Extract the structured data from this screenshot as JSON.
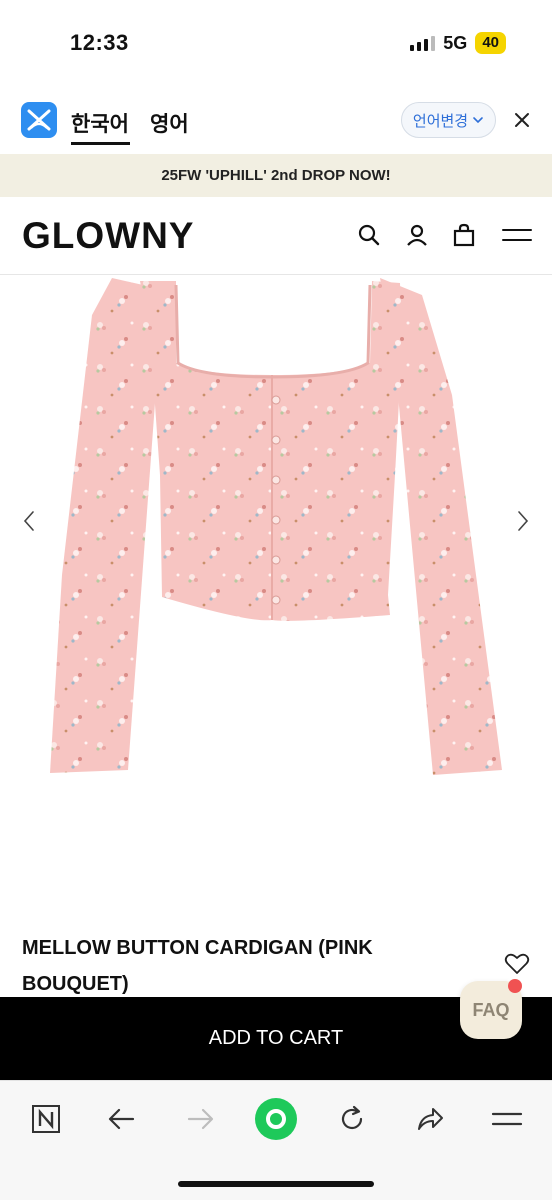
{
  "status_bar": {
    "time": "12:33",
    "network": "5G",
    "battery": "40",
    "accent": "#f5d400"
  },
  "translate_bar": {
    "icon": "translate-app-icon",
    "lang_active": "한국어",
    "lang_inactive": "영어",
    "change_label": "언어변경",
    "change_icon": "chevron-down-icon",
    "close_icon": "close-icon",
    "accent": "#2e8ef0"
  },
  "announcement": {
    "text": "25FW 'UPHILL' 2nd DROP NOW!"
  },
  "header": {
    "logo": "GLOWNY",
    "icons": [
      "search-icon",
      "user-icon",
      "shopping-bag-icon",
      "menu-icon"
    ]
  },
  "product": {
    "image": "pink-floral-cardigan-image",
    "prev_icon": "chevron-left-icon",
    "next_icon": "chevron-right-icon",
    "title": "MELLOW BUTTON CARDIGAN (PINK BOUQUET)",
    "wish_icon": "heart-icon"
  },
  "faq": {
    "label": "FAQ",
    "badge_color": "#f05252"
  },
  "cart": {
    "label": "ADD TO CART"
  },
  "browser_toolbar": {
    "items": [
      "naver-icon",
      "back-arrow-icon",
      "forward-arrow-icon",
      "green-home-icon",
      "reload-icon",
      "share-icon",
      "more-menu-icon"
    ],
    "accent": "#1ec95a"
  }
}
